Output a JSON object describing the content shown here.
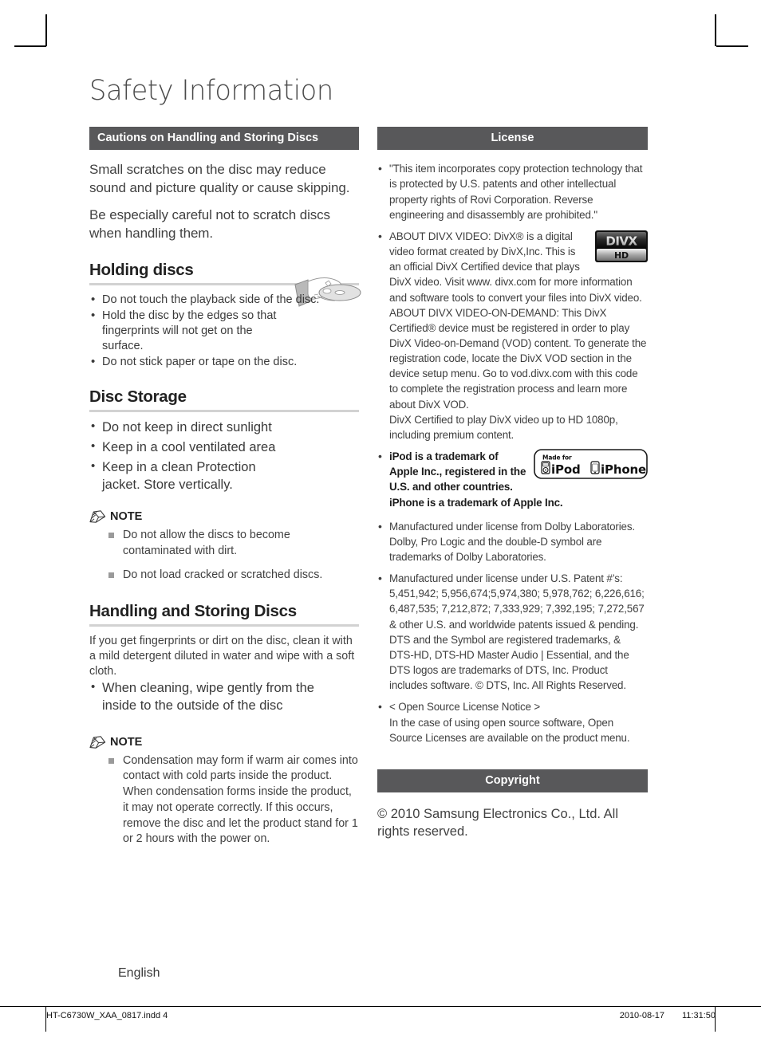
{
  "page": {
    "title": "Safety Information",
    "language_footer": "English"
  },
  "left_column": {
    "bar_title": "Cautions on Handling and Storing Discs",
    "lead_paragraphs": [
      "Small scratches on the disc may reduce sound and picture quality or cause skipping.",
      "Be especially careful not to scratch discs when handling them."
    ],
    "holding_discs": {
      "heading": "Holding discs",
      "items": [
        "Do not touch the playback side of the disc.",
        "Hold the disc by the edges so that fingerprints will not get on the surface.",
        "Do not stick paper or tape on the disc."
      ]
    },
    "disc_storage": {
      "heading": "Disc Storage",
      "items": [
        "Do not keep in direct sunlight",
        "Keep in a cool ventilated area",
        "Keep in a clean Protection jacket. Store vertically."
      ]
    },
    "note_one": {
      "label": "NOTE",
      "items": [
        "Do not allow the discs to become contaminated with dirt.",
        "Do not load cracked or scratched discs."
      ]
    },
    "handling_storing": {
      "heading": "Handling and Storing Discs",
      "intro": "If you get fingerprints or dirt on the disc, clean it with a mild detergent diluted in water and wipe with a soft cloth.",
      "items": [
        "When cleaning, wipe gently from the inside to the outside of the disc"
      ]
    },
    "note_two": {
      "label": "NOTE",
      "items": [
        "Condensation may form if warm air comes into contact with cold parts inside the product. When condensation forms inside the product, it may not operate correctly. If this occurs, remove the disc and let the product stand for 1 or 2 hours with the power on."
      ]
    }
  },
  "right_column": {
    "license_bar_title": "License",
    "license_items": {
      "rovi": "\"This item incorporates copy protection technology that is protected by U.S. patents and other intellectual property rights of Rovi Corporation. Reverse engineering and disassembly are prohibited.\"",
      "divx_video": "ABOUT DIVX VIDEO: DivX® is a digital video format created by DivX,Inc. This is an official DivX Certified device that plays DivX video. Visit www. divx.com for more information and software tools to convert your files into DivX video.",
      "divx_vod": "ABOUT DIVX VIDEO-ON-DEMAND: This DivX Certified® device must be registered in order to play DivX Video-on-Demand (VOD) content. To generate the registration code, locate the DivX VOD section in the device setup menu. Go to vod.divx.com with this code to complete the registration process and learn more about DivX VOD.",
      "divx_hd": "DivX Certified to play DivX video up to HD 1080p, including premium content.",
      "ipod": "iPod is a trademark of Apple Inc., registered in the U.S. and other countries.",
      "iphone": "iPhone is a trademark of Apple Inc.",
      "dolby": "Manufactured under license from Dolby Laboratories. Dolby, Pro Logic and the double-D symbol are trademarks of Dolby Laboratories.",
      "dts_patents": "Manufactured under license under U.S. Patent #’s: 5,451,942; 5,956,674;5,974,380; 5,978,762; 6,226,616; 6,487,535; 7,212,872; 7,333,929; 7,392,195; 7,272,567 & other U.S. and worldwide patents issued & pending.",
      "dts_trademarks": "DTS and the Symbol are registered trademarks, & DTS-HD, DTS-HD Master Audio | Essential, and the DTS logos are trademarks of DTS, Inc. Product includes software. © DTS, Inc. All Rights Reserved.",
      "open_source_title": "< Open Source License Notice >",
      "open_source_body": "In the case of using open source software, Open Source Licenses are available on the product menu."
    },
    "copyright_bar_title": "Copyright",
    "copyright_body": "© 2010 Samsung Electronics Co., Ltd. All rights reserved."
  },
  "logos": {
    "divx_top": "DIVX",
    "divx_bottom": "HD",
    "made_for": "Made for",
    "ipod_word": "iPod",
    "iphone_word": "iPhone"
  },
  "footer": {
    "filename": "HT-C6730W_XAA_0817.indd   4",
    "date": "2010-08-17",
    "time": "11:31:50"
  },
  "colors": {
    "bar_background": "#58585a",
    "bar_text": "#ffffff",
    "body_text": "#3f3f3f",
    "rule": "#d2d2d2"
  }
}
